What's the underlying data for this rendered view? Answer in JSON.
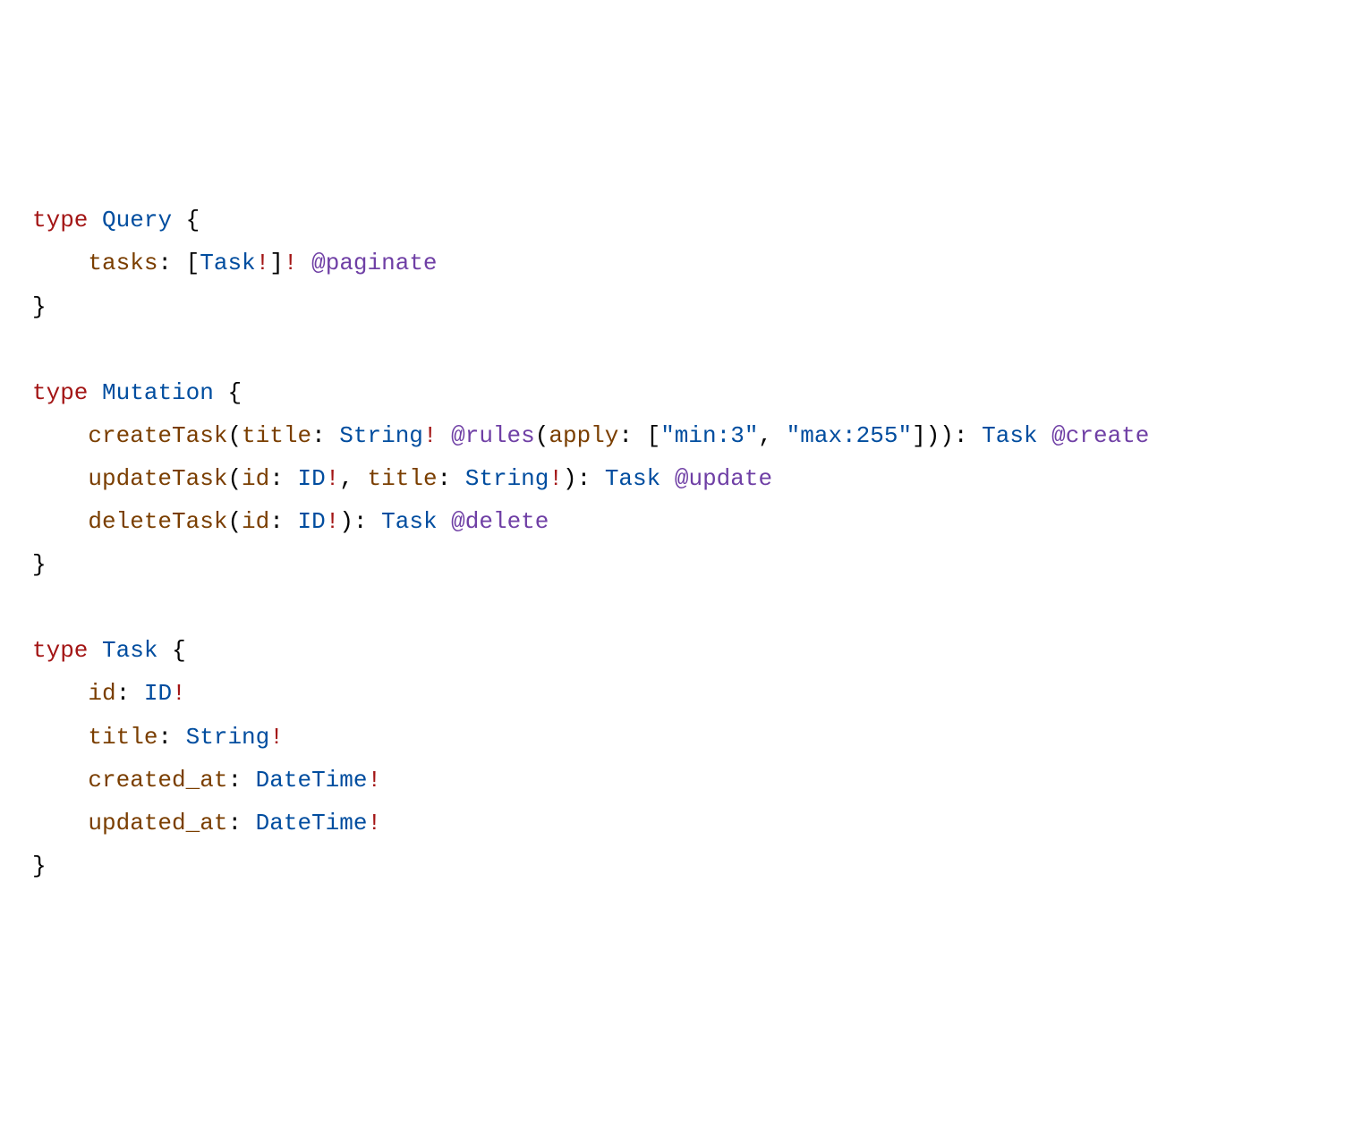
{
  "kw_type": "type",
  "types": {
    "query": "Query",
    "mutation": "Mutation",
    "task": "Task"
  },
  "fields": {
    "tasks": "tasks",
    "createTask": "createTask",
    "updateTask": "updateTask",
    "deleteTask": "deleteTask",
    "id": "id",
    "title": "title",
    "created_at": "created_at",
    "updated_at": "updated_at",
    "apply": "apply"
  },
  "scalars": {
    "Task": "Task",
    "String": "String",
    "ID": "ID",
    "DateTime": "DateTime"
  },
  "directives": {
    "paginate": "@paginate",
    "rules": "@rules",
    "create": "@create",
    "update": "@update",
    "delete": "@delete"
  },
  "strings": {
    "min3": "\"min:3\"",
    "max255": "\"max:255\""
  },
  "punct": {
    "lbrace": "{",
    "rbrace": "}",
    "lbracket": "[",
    "rbracket": "]",
    "lparen": "(",
    "rparen": ")",
    "colon": ":",
    "comma": ",",
    "bang": "!"
  }
}
